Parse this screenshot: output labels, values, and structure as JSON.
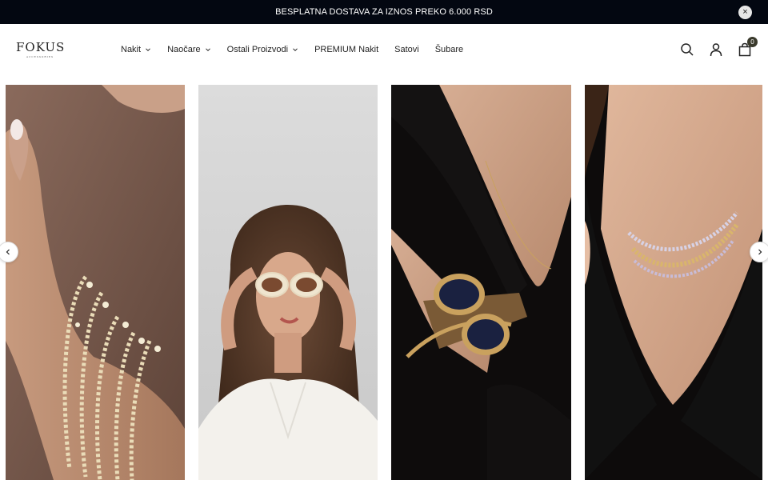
{
  "announcement": {
    "text": "BESPLATNA DOSTAVA ZA IZNOS PREKO 6.000 RSD",
    "close_label": "×"
  },
  "brand": {
    "name": "FOKUS",
    "tagline": "ACCESSORIES"
  },
  "nav": {
    "items": [
      {
        "label": "Nakit",
        "has_dropdown": true
      },
      {
        "label": "Naočare",
        "has_dropdown": true
      },
      {
        "label": "Ostali Proizvodi",
        "has_dropdown": true
      },
      {
        "label": "PREMIUM Nakit",
        "has_dropdown": false
      },
      {
        "label": "Satovi",
        "has_dropdown": false
      },
      {
        "label": "Šubare",
        "has_dropdown": false
      }
    ]
  },
  "header_icons": {
    "search": "search-icon",
    "account": "user-icon",
    "cart": "bag-icon",
    "cart_count": "0"
  },
  "slides": [
    {
      "subject": "bracelets",
      "icon": "bracelet-photo"
    },
    {
      "subject": "sunglasses",
      "icon": "sunglasses-photo"
    },
    {
      "subject": "watch",
      "icon": "watch-photo"
    },
    {
      "subject": "necklace",
      "icon": "necklace-photo"
    }
  ],
  "carousel": {
    "prev_icon": "chevron-left-icon",
    "next_icon": "chevron-right-icon"
  },
  "colors": {
    "announce_bg": "#030711",
    "cart_badge": "#3a3a2c",
    "text": "#111111"
  }
}
